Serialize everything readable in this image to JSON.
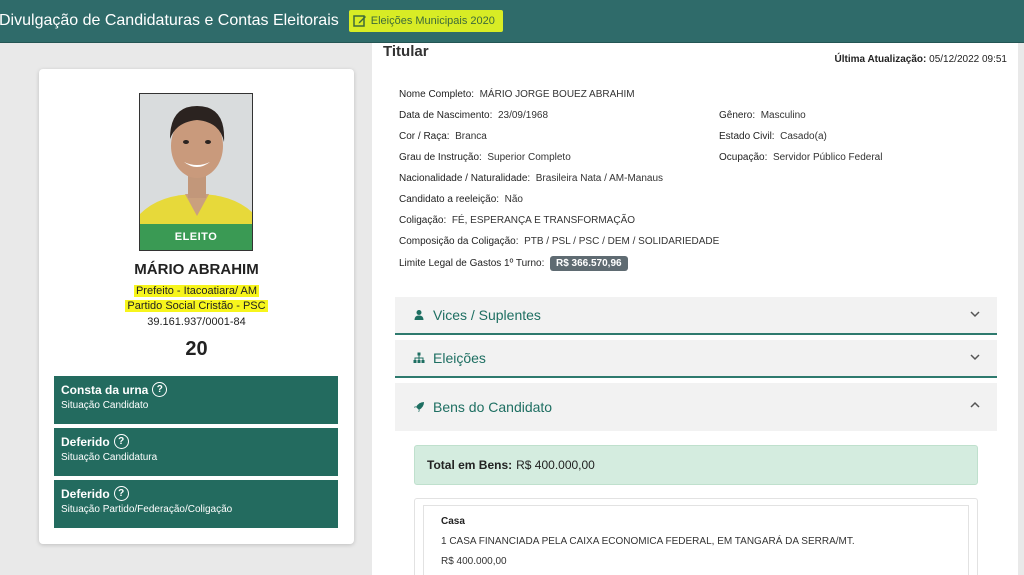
{
  "header": {
    "app_title": "Divulgação de Candidaturas e Contas Eleitorais",
    "election_label": "Eleições Municipais 2020",
    "accent_color": "#d8ec25",
    "bar_color": "#2f6b6a"
  },
  "candidate": {
    "photo_badge": "ELEITO",
    "name": "MÁRIO ABRAHIM",
    "office": "Prefeito - Itacoatiara/ AM",
    "party": "Partido Social Cristão - PSC",
    "cnpj": "39.161.937/0001-84",
    "number": "20",
    "status": [
      {
        "title": "Consta da urna",
        "subtitle": "Situação Candidato"
      },
      {
        "title": "Deferido",
        "subtitle": "Situação Candidatura"
      },
      {
        "title": "Deferido",
        "subtitle": "Situação Partido/Federação/Coligação"
      }
    ]
  },
  "details": {
    "section_title": "Titular",
    "update_label": "Última Atualização:",
    "update_value": "05/12/2022 09:51",
    "fields": {
      "nome_completo": {
        "label": "Nome Completo:",
        "value": "MÁRIO JORGE BOUEZ ABRAHIM"
      },
      "data_nascimento": {
        "label": "Data de Nascimento:",
        "value": "23/09/1968"
      },
      "genero": {
        "label": "Gênero:",
        "value": "Masculino"
      },
      "cor_raca": {
        "label": "Cor / Raça:",
        "value": "Branca"
      },
      "estado_civil": {
        "label": "Estado Civil:",
        "value": "Casado(a)"
      },
      "grau_instrucao": {
        "label": "Grau de Instrução:",
        "value": "Superior Completo"
      },
      "ocupacao": {
        "label": "Ocupação:",
        "value": "Servidor Público Federal"
      },
      "nacionalidade": {
        "label": "Nacionalidade / Naturalidade:",
        "value": "Brasileira Nata / AM-Manaus"
      },
      "reeleicao": {
        "label": "Candidato a reeleição:",
        "value": "Não"
      },
      "coligacao": {
        "label": "Coligação:",
        "value": "FÉ, ESPERANÇA E TRANSFORMAÇÃO"
      },
      "composicao": {
        "label": "Composição da Coligação:",
        "value": "PTB / PSL / PSC / DEM / SOLIDARIEDADE"
      },
      "limite_gastos": {
        "label": "Limite Legal de Gastos 1º Turno:",
        "value": "R$ 366.570,96"
      }
    }
  },
  "accordion": {
    "vices": "Vices / Suplentes",
    "eleicoes": "Eleições",
    "bens": "Bens do Candidato"
  },
  "bens": {
    "total_label": "Total em Bens:",
    "total_value": "R$ 400.000,00",
    "items": [
      {
        "type": "Casa",
        "description": "1 CASA FINANCIADA PELA CAIXA ECONOMICA FEDERAL, EM TANGARÁ DA SERRA/MT.",
        "value": "R$ 400.000,00"
      }
    ]
  }
}
